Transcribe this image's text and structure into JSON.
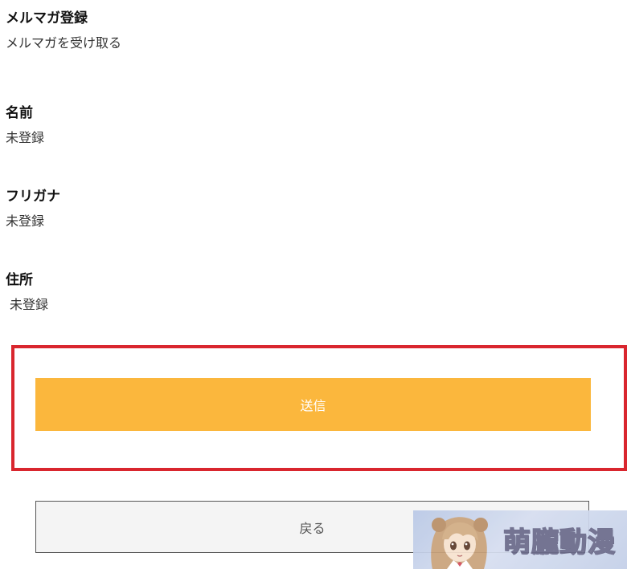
{
  "fields": [
    {
      "label": "メルマガ登録",
      "value": "メルマガを受け取る"
    },
    {
      "label": "名前",
      "value": "未登録"
    },
    {
      "label": "フリガナ",
      "value": "未登録"
    },
    {
      "label": "住所",
      "value": "未登録"
    }
  ],
  "actions": {
    "submit_label": "送信",
    "back_label": "戻る"
  },
  "watermark": {
    "text": "萌朧動漫"
  },
  "colors": {
    "submit_bg": "#fbb73d",
    "highlight_border": "#d9262e",
    "back_bg": "#f4f4f4"
  }
}
